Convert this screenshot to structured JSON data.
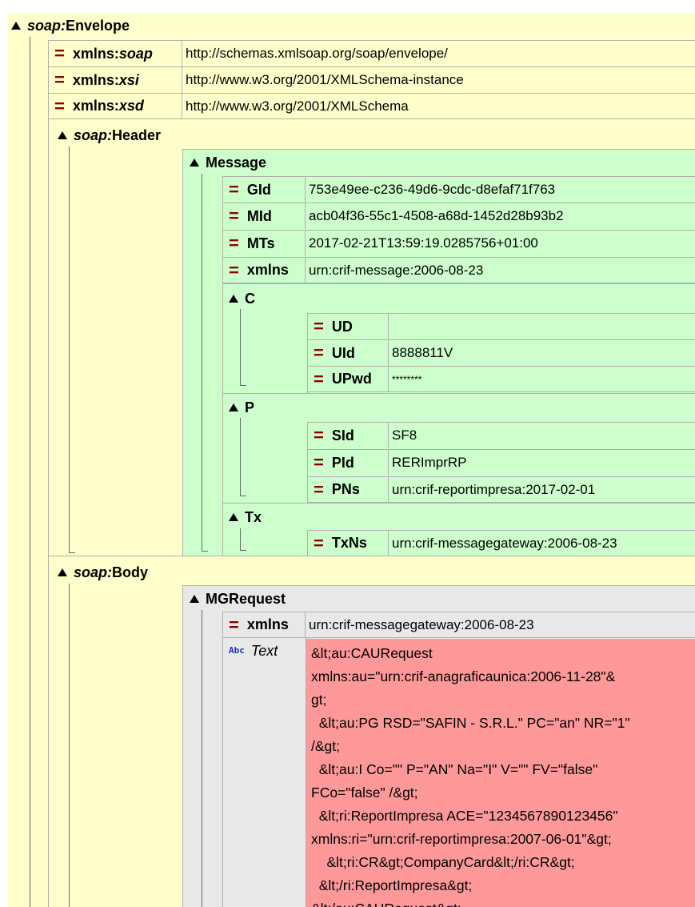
{
  "envelope": {
    "prefix": "soap:",
    "name": "Envelope",
    "attrs": [
      {
        "prefix": "xmlns:",
        "ns": "soap",
        "value": "http://schemas.xmlsoap.org/soap/envelope/"
      },
      {
        "prefix": "xmlns:",
        "ns": "xsi",
        "value": "http://www.w3.org/2001/XMLSchema-instance"
      },
      {
        "prefix": "xmlns:",
        "ns": "xsd",
        "value": "http://www.w3.org/2001/XMLSchema"
      }
    ]
  },
  "header": {
    "prefix": "soap:",
    "name": "Header",
    "message": {
      "name": "Message",
      "attrs": [
        {
          "name": "GId",
          "value": "753e49ee-c236-49d6-9cdc-d8efaf71f763"
        },
        {
          "name": "MId",
          "value": "acb04f36-55c1-4508-a68d-1452d28b93b2"
        },
        {
          "name": "MTs",
          "value": "2017-02-21T13:59:19.0285756+01:00"
        },
        {
          "name": "xmlns",
          "value": "urn:crif-message:2006-08-23"
        }
      ],
      "c": {
        "name": "C",
        "attrs": [
          {
            "name": "UD",
            "value": ""
          },
          {
            "name": "UId",
            "value": "8888811V"
          },
          {
            "name": "UPwd",
            "value": "********"
          }
        ]
      },
      "p": {
        "name": "P",
        "attrs": [
          {
            "name": "SId",
            "value": "SF8"
          },
          {
            "name": "PId",
            "value": "RERImprRP"
          },
          {
            "name": "PNs",
            "value": "urn:crif-reportimpresa:2017-02-01"
          }
        ]
      },
      "tx": {
        "name": "Tx",
        "attrs": [
          {
            "name": "TxNs",
            "value": "urn:crif-messagegateway:2006-08-23"
          }
        ]
      }
    }
  },
  "body": {
    "prefix": "soap:",
    "name": "Body",
    "mgrequest": {
      "name": "MGRequest",
      "attrs": [
        {
          "name": "xmlns",
          "value": "urn:crif-messagegateway:2006-08-23"
        }
      ],
      "text_node": {
        "icon": "Abc",
        "label": "Text",
        "content": "&lt;au:CAURequest\nxmlns:au=\"urn:crif-anagraficaunica:2006-11-28\"&\ngt;\n  &lt;au:PG RSD=\"SAFIN - S.R.L.\" PC=\"an\" NR=\"1\"\n/&gt;\n  &lt;au:I Co=\"\" P=\"AN\" Na=\"I\" V=\"\" FV=\"false\"\nFCo=\"false\" /&gt;\n  &lt;ri:ReportImpresa ACE=\"1234567890123456\"\nxmlns:ri=\"urn:crif-reportimpresa:2007-06-01\"&gt;\n    &lt;ri:CR&gt;CompanyCard&lt;/ri:CR&gt;\n  &lt;/ri:ReportImpresa&gt;\n&lt;/au:CAURequest&gt;"
      }
    }
  },
  "colors": {
    "yellow": "#ffffcc",
    "green": "#ccffcc",
    "gray": "#e8e8e8",
    "red": "#ff9999",
    "eq": "#8b0000"
  }
}
